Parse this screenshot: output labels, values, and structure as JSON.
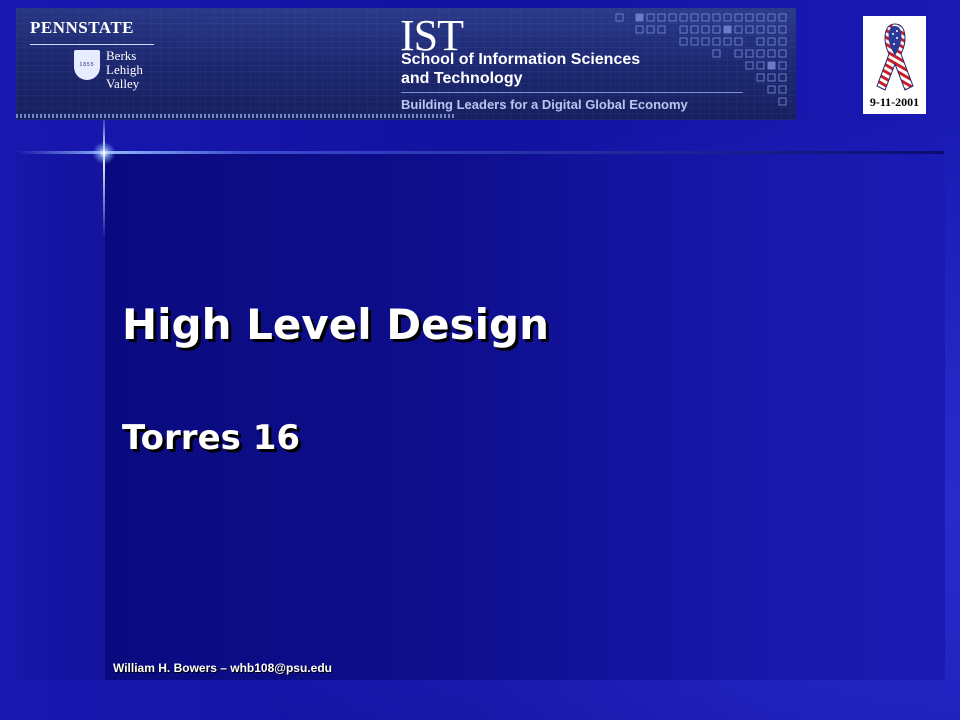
{
  "banner": {
    "psu_name": "PENNSTATE",
    "shield_year": "1855",
    "campus_line1": "Berks",
    "campus_line2": "Lehigh Valley",
    "ist_logo": "IST",
    "ist_school_line1": "School of Information Sciences",
    "ist_school_line2": "and Technology",
    "ist_tagline": "Building Leaders for a Digital Global Economy"
  },
  "badge": {
    "date": "9-11-2001",
    "icon": "flag-ribbon-icon"
  },
  "slide": {
    "title": "High Level Design",
    "subtitle": "Torres 16",
    "footer": "William H. Bowers – whb108@psu.edu"
  },
  "colors": {
    "background": "#1414a8",
    "panel": "#0a0a80",
    "text": "#ffffff"
  }
}
